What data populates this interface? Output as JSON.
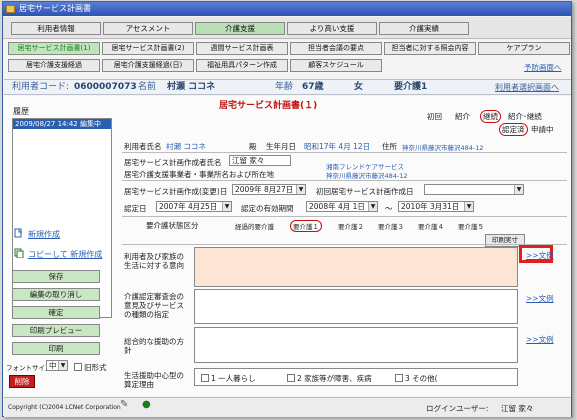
{
  "window": {
    "title": "居宅サービス計画書"
  },
  "nav_top": [
    "利用者情報",
    "アセスメント",
    "介護支援",
    "より高い支援",
    "介護実績"
  ],
  "nav_sub1": [
    "居宅サービス計画書(1)",
    "居宅サービス計画書(2)",
    "週間サービス計画表",
    "担当者会議の要点",
    "担当者に対する照会内容",
    "ケアプラン"
  ],
  "nav_sub2": [
    "居宅介護支援経過",
    "居宅介護支援経過(日)",
    "福祉用具パターン作成",
    "顧客スケジュール"
  ],
  "links": {
    "preview": "予防画面へ",
    "select_user": "利用者選択画面へ"
  },
  "infobar": {
    "code_label": "利用者コード:",
    "code": "0600007073",
    "name_label": "名前",
    "name": "村瀬 ココネ",
    "age_label": "年齢",
    "age": "67歳",
    "sex": "女",
    "care_level": "要介護1"
  },
  "plan_title": "居宅サービス計画書(１)",
  "history": {
    "label": "履歴",
    "items": [
      "2009/08/27 14:42 編集中"
    ]
  },
  "top_right": {
    "labels": [
      "初回",
      "紹介",
      "継続",
      "紹介･継続"
    ],
    "certified": "認定済",
    "applying": "申請中"
  },
  "side_links": {
    "new": "新規作成",
    "copy_new": "コピーして 新規作成"
  },
  "actions": {
    "save": "保存",
    "cancel_edit": "編集の取り消し",
    "confirm": "確定",
    "print_preview": "印刷プレビュー",
    "print": "印刷",
    "delete": "削除"
  },
  "font_size": {
    "label": "フォントサイズ",
    "value": "中",
    "old_format": "旧形式"
  },
  "form": {
    "user_name_label": "利用者氏名",
    "user_name": "村瀬 ココネ",
    "honorific": "殿",
    "birthday_label": "生年月日",
    "birthday": "昭和17年 4月 12日",
    "address_label": "住所",
    "address": "神奈川県藤沢市藤沢484-12",
    "creator_label": "居宅サービス計画作成者氏名",
    "creator": "江留 家々",
    "office_label": "居宅介護支援事業者・事業所名および所在地",
    "office_name": "湘南フレンドケアサービス",
    "office_addr": "神奈川県藤沢市藤沢484-12",
    "created_label": "居宅サービス計画作成(変更)日",
    "created": "2009年 8月27日",
    "first_label": "初回居宅サービス計画作成日",
    "cert_label": "認定日",
    "cert_date": "2007年 4月25日",
    "valid_label": "認定の有効期間",
    "valid_from": "2008年 4月 1日",
    "valid_sep": "～",
    "valid_to": "2010年 3月31日",
    "care_cat_label": "要介護状態区分",
    "care_options": [
      "経過的要介護",
      "要介護１",
      "要介護２",
      "要介護３",
      "要介護４",
      "要介護５"
    ],
    "print_btn": "印刷実寸",
    "intent_label": "利用者及び家族の生活に対する意向",
    "committee_label": "介護認定審査会の意見及びサービスの種類の指定",
    "policy_label": "総合的な援助の方針",
    "example_link": ">>文例",
    "life_label": "生活援助中心型の算定理由",
    "life_options": [
      "1 一人暮らし",
      "2 家族等が障害、疾病",
      "3 その他("
    ]
  },
  "footer": {
    "copyright": "Copyright (C)2004 LCNet Corporation",
    "login_label": "ログインユーザー:",
    "login_user": "江留 家々"
  }
}
